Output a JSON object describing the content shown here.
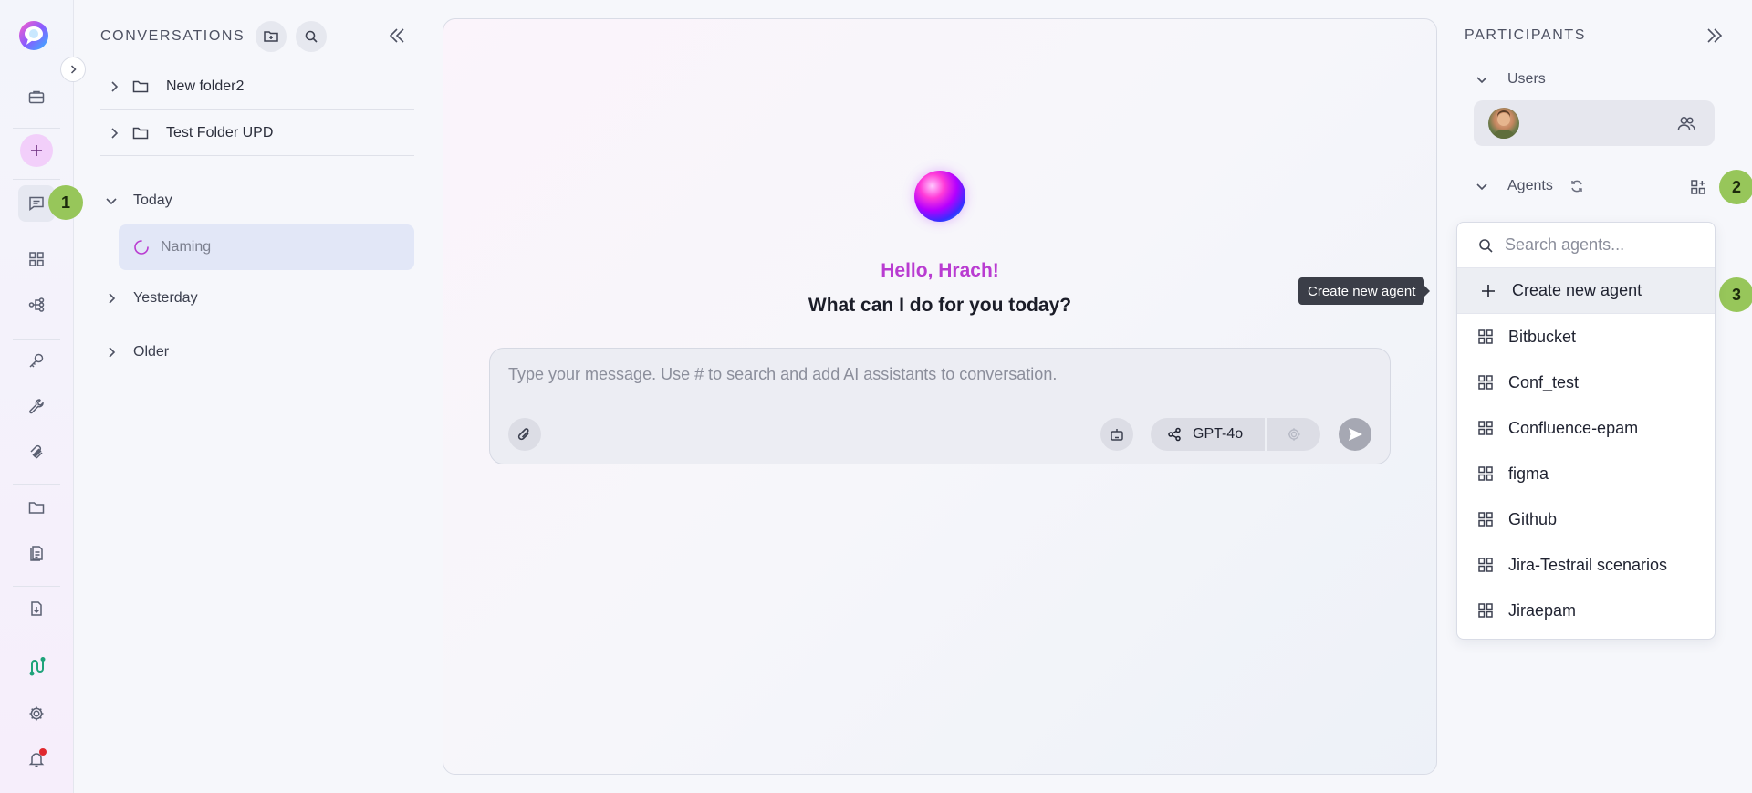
{
  "rail": {
    "badge_1": "1"
  },
  "conversations": {
    "title": "CONVERSATIONS",
    "folders": [
      {
        "label": "New folder2"
      },
      {
        "label": "Test Folder UPD"
      }
    ],
    "groups": {
      "today": "Today",
      "yesterday": "Yesterday",
      "older": "Older"
    },
    "today_items": [
      {
        "label": "Naming"
      }
    ]
  },
  "chat": {
    "greeting": "Hello, Hrach!",
    "prompt": "What can I do for you today?",
    "composer_placeholder": "Type your message. Use # to search and add AI assistants to conversation.",
    "model_label": "GPT-4o"
  },
  "tooltip": {
    "text": "Create new agent"
  },
  "participants": {
    "title": "PARTICIPANTS",
    "users_label": "Users",
    "agents_label": "Agents",
    "badge_2": "2",
    "badge_3": "3",
    "search_placeholder": "Search agents...",
    "create_label": "Create new agent",
    "agents": [
      {
        "label": "Bitbucket"
      },
      {
        "label": "Conf_test"
      },
      {
        "label": "Confluence-epam"
      },
      {
        "label": "figma"
      },
      {
        "label": "Github"
      },
      {
        "label": "Jira-Testrail scenarios"
      },
      {
        "label": "Jiraepam"
      }
    ]
  },
  "colors": {
    "accent_badge": "#97c65a",
    "greeting": "#b93cd1",
    "active_item": "#e2e7f7",
    "notification": "#e0282e"
  }
}
